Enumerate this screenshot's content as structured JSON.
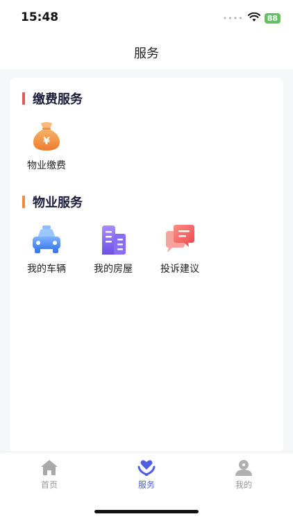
{
  "status_bar": {
    "time": "15:48",
    "signal_icon": "cellular-dots-icon",
    "wifi_icon": "wifi-icon",
    "battery_level": "88",
    "battery_color": "#5fc45f"
  },
  "nav": {
    "title": "服务"
  },
  "sections": {
    "payment": {
      "title": "缴费服务",
      "accent_color": "#e05a5a",
      "items": [
        {
          "label": "物业缴费",
          "icon": "money-bag-icon"
        }
      ]
    },
    "property": {
      "title": "物业服务",
      "accent_color": "#ee8a3a",
      "items": [
        {
          "label": "我的车辆",
          "icon": "car-icon"
        },
        {
          "label": "我的房屋",
          "icon": "building-icon"
        },
        {
          "label": "投诉建议",
          "icon": "chat-bubble-icon"
        }
      ]
    }
  },
  "tab_bar": {
    "accent_color": "#4f5fe0",
    "tabs": [
      {
        "label": "首页",
        "icon": "home-icon",
        "active": false
      },
      {
        "label": "服务",
        "icon": "heart-hands-icon",
        "active": true
      },
      {
        "label": "我的",
        "icon": "user-icon",
        "active": false
      }
    ]
  }
}
